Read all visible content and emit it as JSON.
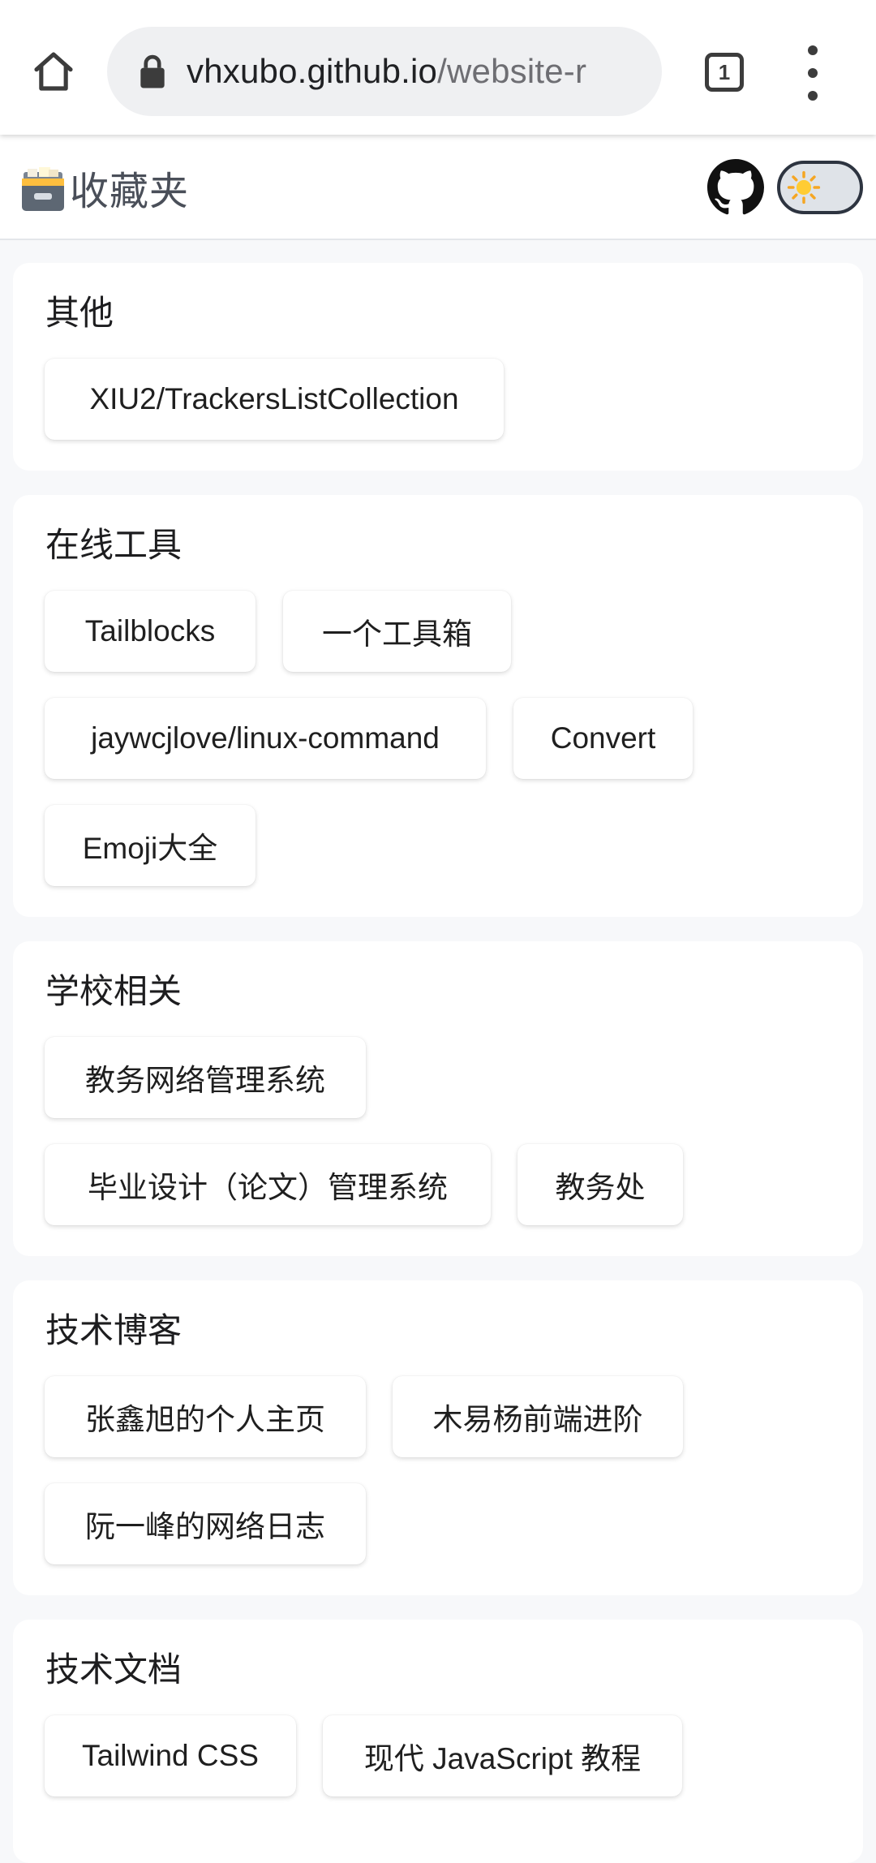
{
  "browser": {
    "url_host": "vhxubo.github.io",
    "url_path": "/website-r",
    "tab_count": "1"
  },
  "site": {
    "title": "收藏夹"
  },
  "sections": [
    {
      "title": "其他",
      "links": [
        "XIU2/TrackersListCollection"
      ]
    },
    {
      "title": "在线工具",
      "links": [
        "Tailblocks",
        "一个工具箱",
        "jaywcjlove/linux-command",
        "Convert",
        "Emoji大全"
      ]
    },
    {
      "title": "学校相关",
      "links": [
        "教务网络管理系统",
        "毕业设计（论文）管理系统",
        "教务处"
      ]
    },
    {
      "title": "技术博客",
      "links": [
        "张鑫旭的个人主页",
        "木易杨前端进阶",
        "阮一峰的网络日志"
      ]
    },
    {
      "title": "技术文档",
      "links": [
        "Tailwind CSS",
        "现代 JavaScript 教程"
      ]
    }
  ]
}
